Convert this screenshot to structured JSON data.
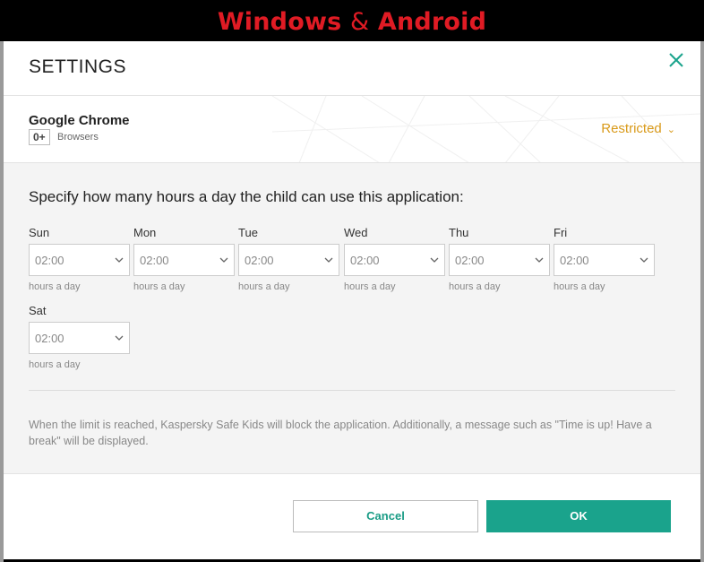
{
  "banner": {
    "left": "Windows",
    "amp": "&",
    "right": "Android"
  },
  "dialog": {
    "title": "SETTINGS",
    "close_icon": "close-icon"
  },
  "app": {
    "name": "Google Chrome",
    "age_rating": "0+",
    "category": "Browsers",
    "restriction": "Restricted"
  },
  "schedule": {
    "heading": "Specify how many hours a day the child can use this application:",
    "unit_hint": "hours a day",
    "days": [
      {
        "label": "Sun",
        "value": "02:00"
      },
      {
        "label": "Mon",
        "value": "02:00"
      },
      {
        "label": "Tue",
        "value": "02:00"
      },
      {
        "label": "Wed",
        "value": "02:00"
      },
      {
        "label": "Thu",
        "value": "02:00"
      },
      {
        "label": "Fri",
        "value": "02:00"
      },
      {
        "label": "Sat",
        "value": "02:00"
      }
    ],
    "note": "When the limit is reached, Kaspersky Safe Kids will block the application. Additionally, a message such as \"Time is up! Have a break\" will be displayed."
  },
  "footer": {
    "cancel_label": "Cancel",
    "ok_label": "OK"
  },
  "colors": {
    "accent": "#1aa38c",
    "warning": "#d99a1a",
    "banner": "#e01b24"
  }
}
